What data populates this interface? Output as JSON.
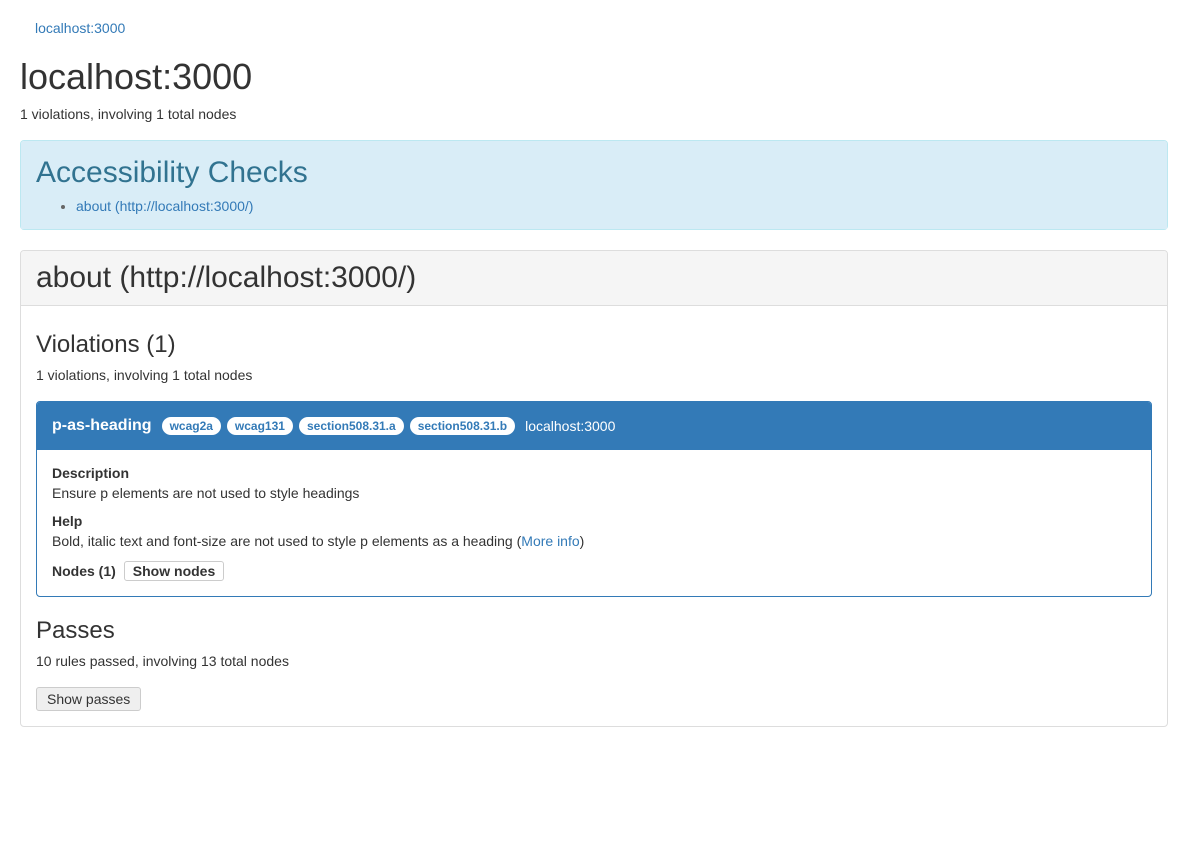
{
  "breadcrumb": "localhost:3000",
  "pageTitle": "localhost:3000",
  "summary": "1 violations, involving 1 total nodes",
  "checksPanel": {
    "title": "Accessibility Checks",
    "items": [
      {
        "label": "about (http://localhost:3000/)"
      }
    ]
  },
  "section": {
    "heading": "about (http://localhost:3000/)",
    "violations": {
      "heading": "Violations (1)",
      "summary": "1 violations, involving 1 total nodes",
      "items": [
        {
          "rule": "p-as-heading",
          "tags": [
            "wcag2a",
            "wcag131",
            "section508.31.a",
            "section508.31.b"
          ],
          "host": "localhost:3000",
          "descriptionLabel": "Description",
          "description": "Ensure p elements are not used to style headings",
          "helpLabel": "Help",
          "helpText": "Bold, italic text and font-size are not used to style p elements as a heading (",
          "moreInfoLabel": "More info",
          "helpTextClose": ")",
          "nodesLabel": "Nodes (1)",
          "showNodesLabel": "Show nodes"
        }
      ]
    },
    "passes": {
      "heading": "Passes",
      "summary": "10 rules passed, involving 13 total nodes",
      "showPassesLabel": "Show passes"
    }
  }
}
